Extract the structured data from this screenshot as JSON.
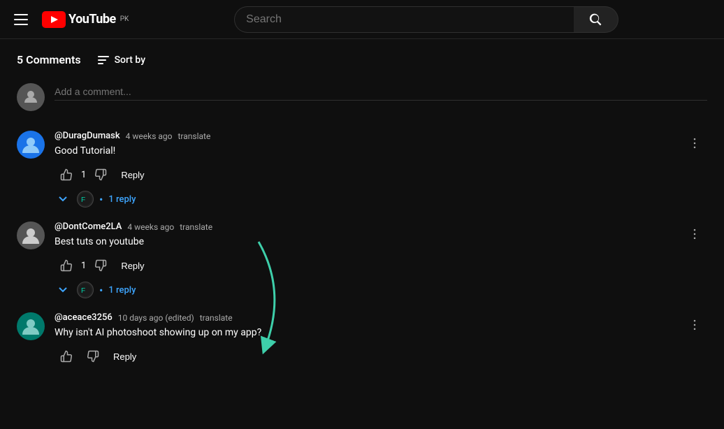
{
  "header": {
    "menu_label": "Menu",
    "logo_text": "YouTube",
    "logo_country": "PK",
    "search_placeholder": "Search",
    "search_button_label": "Search"
  },
  "comments": {
    "count_label": "5 Comments",
    "sort_by_label": "Sort by",
    "add_comment_placeholder": "Add a comment...",
    "items": [
      {
        "id": "comment-1",
        "author": "@DuragDumask",
        "time": "4 weeks ago",
        "translate": "translate",
        "text": "Good Tutorial!",
        "likes": "1",
        "replies_count": "1 reply",
        "has_replies": true
      },
      {
        "id": "comment-2",
        "author": "@DontCome2LA",
        "time": "4 weeks ago",
        "translate": "translate",
        "text": "Best tuts on youtube",
        "likes": "1",
        "replies_count": "1 reply",
        "has_replies": true
      },
      {
        "id": "comment-3",
        "author": "@aceace3256",
        "time": "10 days ago (edited)",
        "translate": "translate",
        "text": "Why isn't AI photoshoot showing up on my app?",
        "likes": "",
        "replies_count": "",
        "has_replies": false
      }
    ],
    "reply_label": "Reply",
    "like_icon": "👍",
    "dislike_icon": "👎"
  },
  "arrow": {
    "color": "#3ecfaa",
    "visible": true
  }
}
